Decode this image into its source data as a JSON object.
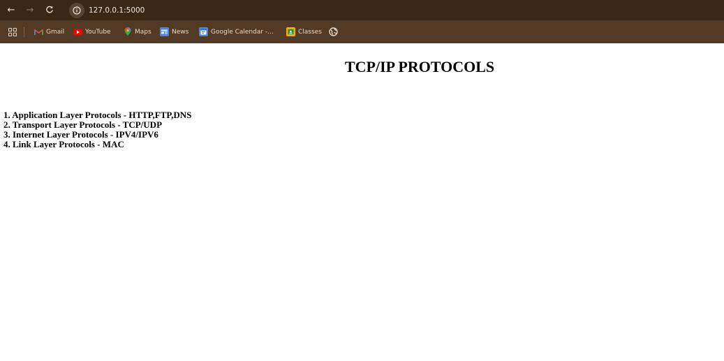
{
  "browser": {
    "url": "127.0.0.1:5000",
    "back_icon": "←",
    "forward_icon": "→",
    "reload_icon": "C",
    "toolbar_color": "#3a2716",
    "bookmarks_bar_color": "#533a24"
  },
  "bookmarks": {
    "apps_icon": "apps-grid-icon",
    "items": [
      {
        "label": "Gmail",
        "icon": "gmail-icon",
        "color": "#ea4335"
      },
      {
        "label": "YouTube",
        "icon": "youtube-icon",
        "color": "#ff0000"
      },
      {
        "label": "Maps",
        "icon": "maps-pin-icon",
        "color": "#34a853"
      },
      {
        "label": "News",
        "icon": "news-icon",
        "color": "#4285f4"
      },
      {
        "label": "Google Calendar -...",
        "icon": "calendar-icon",
        "color": "#4285f4"
      },
      {
        "label": "Classes",
        "icon": "classes-icon",
        "color": "#f9ab00"
      },
      {
        "label": "",
        "icon": "globe-icon",
        "color": "#e6dbcf"
      }
    ]
  },
  "page": {
    "heading": "TCP/IP PROTOCOLS",
    "protocols": [
      "1. Application Layer Protocols - HTTP,FTP,DNS",
      "2. Transport Layer Protocols - TCP/UDP",
      "3. Internet Layer Protocols - IPV4/IPV6",
      "4. Link Layer Protocols - MAC"
    ]
  }
}
